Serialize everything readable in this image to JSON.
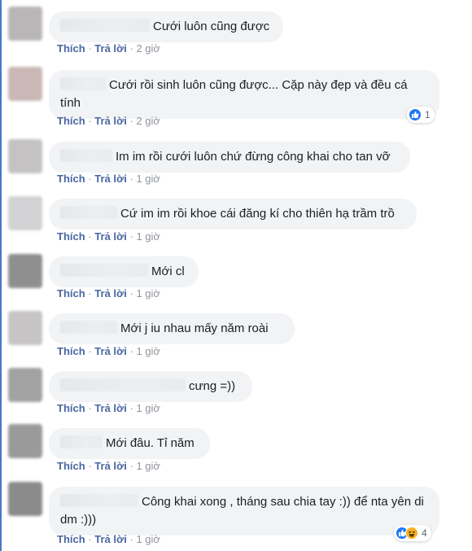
{
  "actions": {
    "like": "Thích",
    "reply": "Trả lời",
    "separator": "·"
  },
  "comments": [
    {
      "text": "Cưới luôn cũng được",
      "time": "2 giờ",
      "avatar_color": "#b9b6b8"
    },
    {
      "text": "Cưới rồi sinh luôn cũng được... Cặp này đẹp và đều cá tính",
      "time": "2 giờ",
      "avatar_color": "#c9b8b6",
      "reactions": {
        "icons": [
          "like-icon"
        ],
        "count": "1"
      }
    },
    {
      "text": "Im im rồi cưới luôn chứ đừng công khai cho tan vỡ",
      "time": "1 giờ",
      "avatar_color": "#c4c2c2"
    },
    {
      "text": "Cứ im im rồi khoe cái đăng kí cho thiên hạ trầm trồ",
      "time": "1 giờ",
      "avatar_color": "#d2d2d4"
    },
    {
      "text": "Mới cl",
      "time": "1 giờ",
      "avatar_color": "#8f8f90"
    },
    {
      "text": "Mới j iu nhau mấy năm roài",
      "time": "1 giờ",
      "avatar_color": "#c6c4c4"
    },
    {
      "text": "cưng =))",
      "time": "1 giờ",
      "avatar_color": "#a2a2a3"
    },
    {
      "text": "Mới đâu. Tỉ năm",
      "time": "1 giờ",
      "avatar_color": "#9a9a9b"
    },
    {
      "text": "Công khai xong , tháng sau chia tay :)) để nta yên di dm :)))",
      "time": "1 giờ",
      "avatar_color": "#8c8b8c",
      "reactions": {
        "icons": [
          "like-icon",
          "haha-icon"
        ],
        "count": "4"
      }
    }
  ]
}
